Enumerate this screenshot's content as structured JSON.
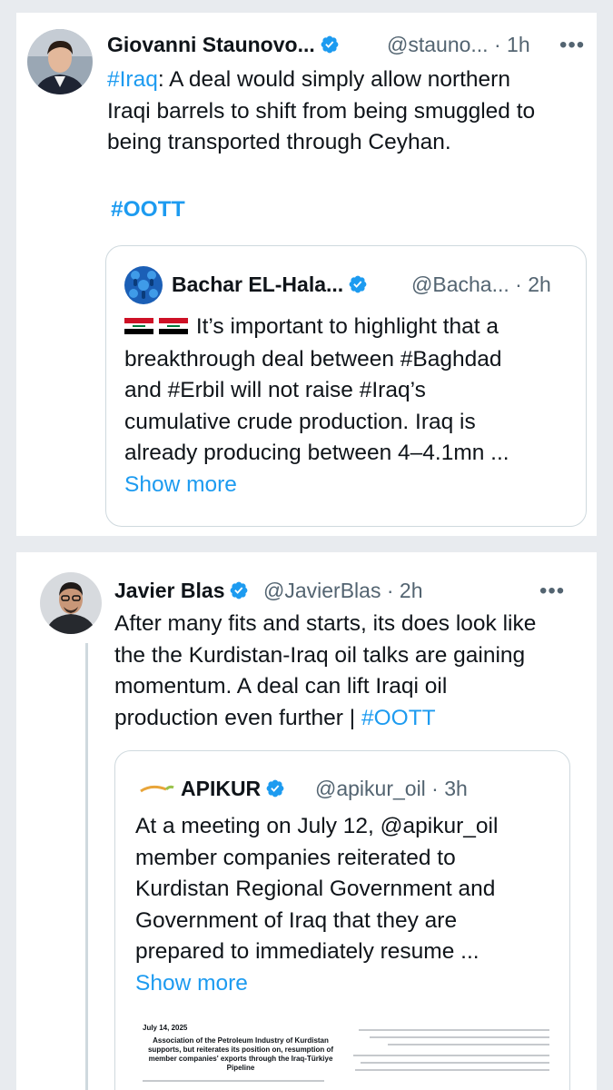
{
  "tweet1": {
    "author_name": "Giovanni Staunovo...",
    "handle": "@stauno...",
    "time": "1h",
    "more": "•••",
    "hashtag_iraq": "#Iraq",
    "text_line1_rest": ":  A deal would simply allow northern",
    "text_line2": "Iraqi barrels to shift from being smuggled to",
    "text_line3": "being transported through Ceyhan.",
    "hashtag_oott": "#OOTT",
    "quote": {
      "author_name": "Bachar EL-Hala...",
      "handle": "@Bacha...",
      "time": "2h",
      "flags": "🇮🇶🇮🇶",
      "line1": "It’s important to highlight that a",
      "line2": "breakthrough deal between #Baghdad",
      "line3": "and #Erbil will not raise #Iraq’s",
      "line4": "cumulative crude production. Iraq is",
      "line5": "already producing between 4–4.1mn ...",
      "show_more": "Show more"
    }
  },
  "tweet2": {
    "author_name": "Javier Blas",
    "handle": "@JavierBlas",
    "time": "2h",
    "more": "•••",
    "line1": "After many fits and starts, its does look like",
    "line2": "the the Kurdistan-Iraq oil talks are gaining",
    "line3": "momentum. A deal can lift Iraqi oil",
    "line4_text": "production even further | ",
    "line4_hashtag": "#OOTT",
    "quote": {
      "author_name": "APIKUR",
      "handle": "@apikur_oil",
      "time": "3h",
      "logo_text": "APIKUR",
      "line1": "At a meeting on July 12, @apikur_oil",
      "line2": "member companies reiterated to",
      "line3": "Kurdistan Regional Government and",
      "line4": "Government of Iraq that they are",
      "line5": "prepared to immediately resume ...",
      "show_more": "Show more",
      "document": {
        "date": "July 14, 2025",
        "title": "Association of the Petroleum Industry of Kurdistan supports, but reiterates its position on, resumption of member companies' exports through the Iraq-Türkiye Pipeline"
      }
    }
  },
  "colors": {
    "link": "#1d9bf0",
    "verified": "#1d9bf0",
    "secondary": "#536471",
    "border": "#cfd9de"
  }
}
